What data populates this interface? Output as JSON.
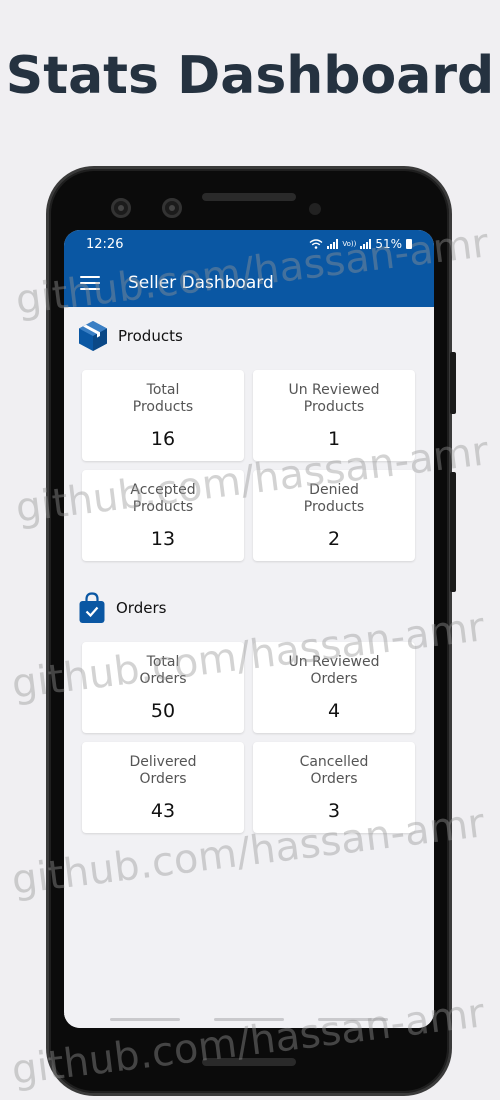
{
  "headline": "Stats Dashboard",
  "status_bar": {
    "time": "12:26",
    "network": "Vo))",
    "battery": "51%"
  },
  "toolbar": {
    "title": "Seller Dashboard",
    "menu_icon": "hamburger-icon"
  },
  "products": {
    "heading": "Products",
    "icon": "box-icon",
    "cards": [
      {
        "line1": "Total",
        "line2": "Products",
        "value": "16"
      },
      {
        "line1": "Un Reviewed",
        "line2": "Products",
        "value": "1"
      },
      {
        "line1": "Accepted",
        "line2": "Products",
        "value": "13"
      },
      {
        "line1": "Denied",
        "line2": "Products",
        "value": "2"
      }
    ]
  },
  "orders": {
    "heading": "Orders",
    "icon": "shopping-bag-icon",
    "cards": [
      {
        "line1": "Total",
        "line2": "Orders",
        "value": "50"
      },
      {
        "line1": "Un Reviewed",
        "line2": "Orders",
        "value": "4"
      },
      {
        "line1": "Delivered",
        "line2": "Orders",
        "value": "43"
      },
      {
        "line1": "Cancelled",
        "line2": "Orders",
        "value": "3"
      }
    ]
  },
  "watermark": "github.com/hassan-amr",
  "colors": {
    "primary": "#0a57a3",
    "headline": "#253240",
    "background": "#f0eff2"
  }
}
